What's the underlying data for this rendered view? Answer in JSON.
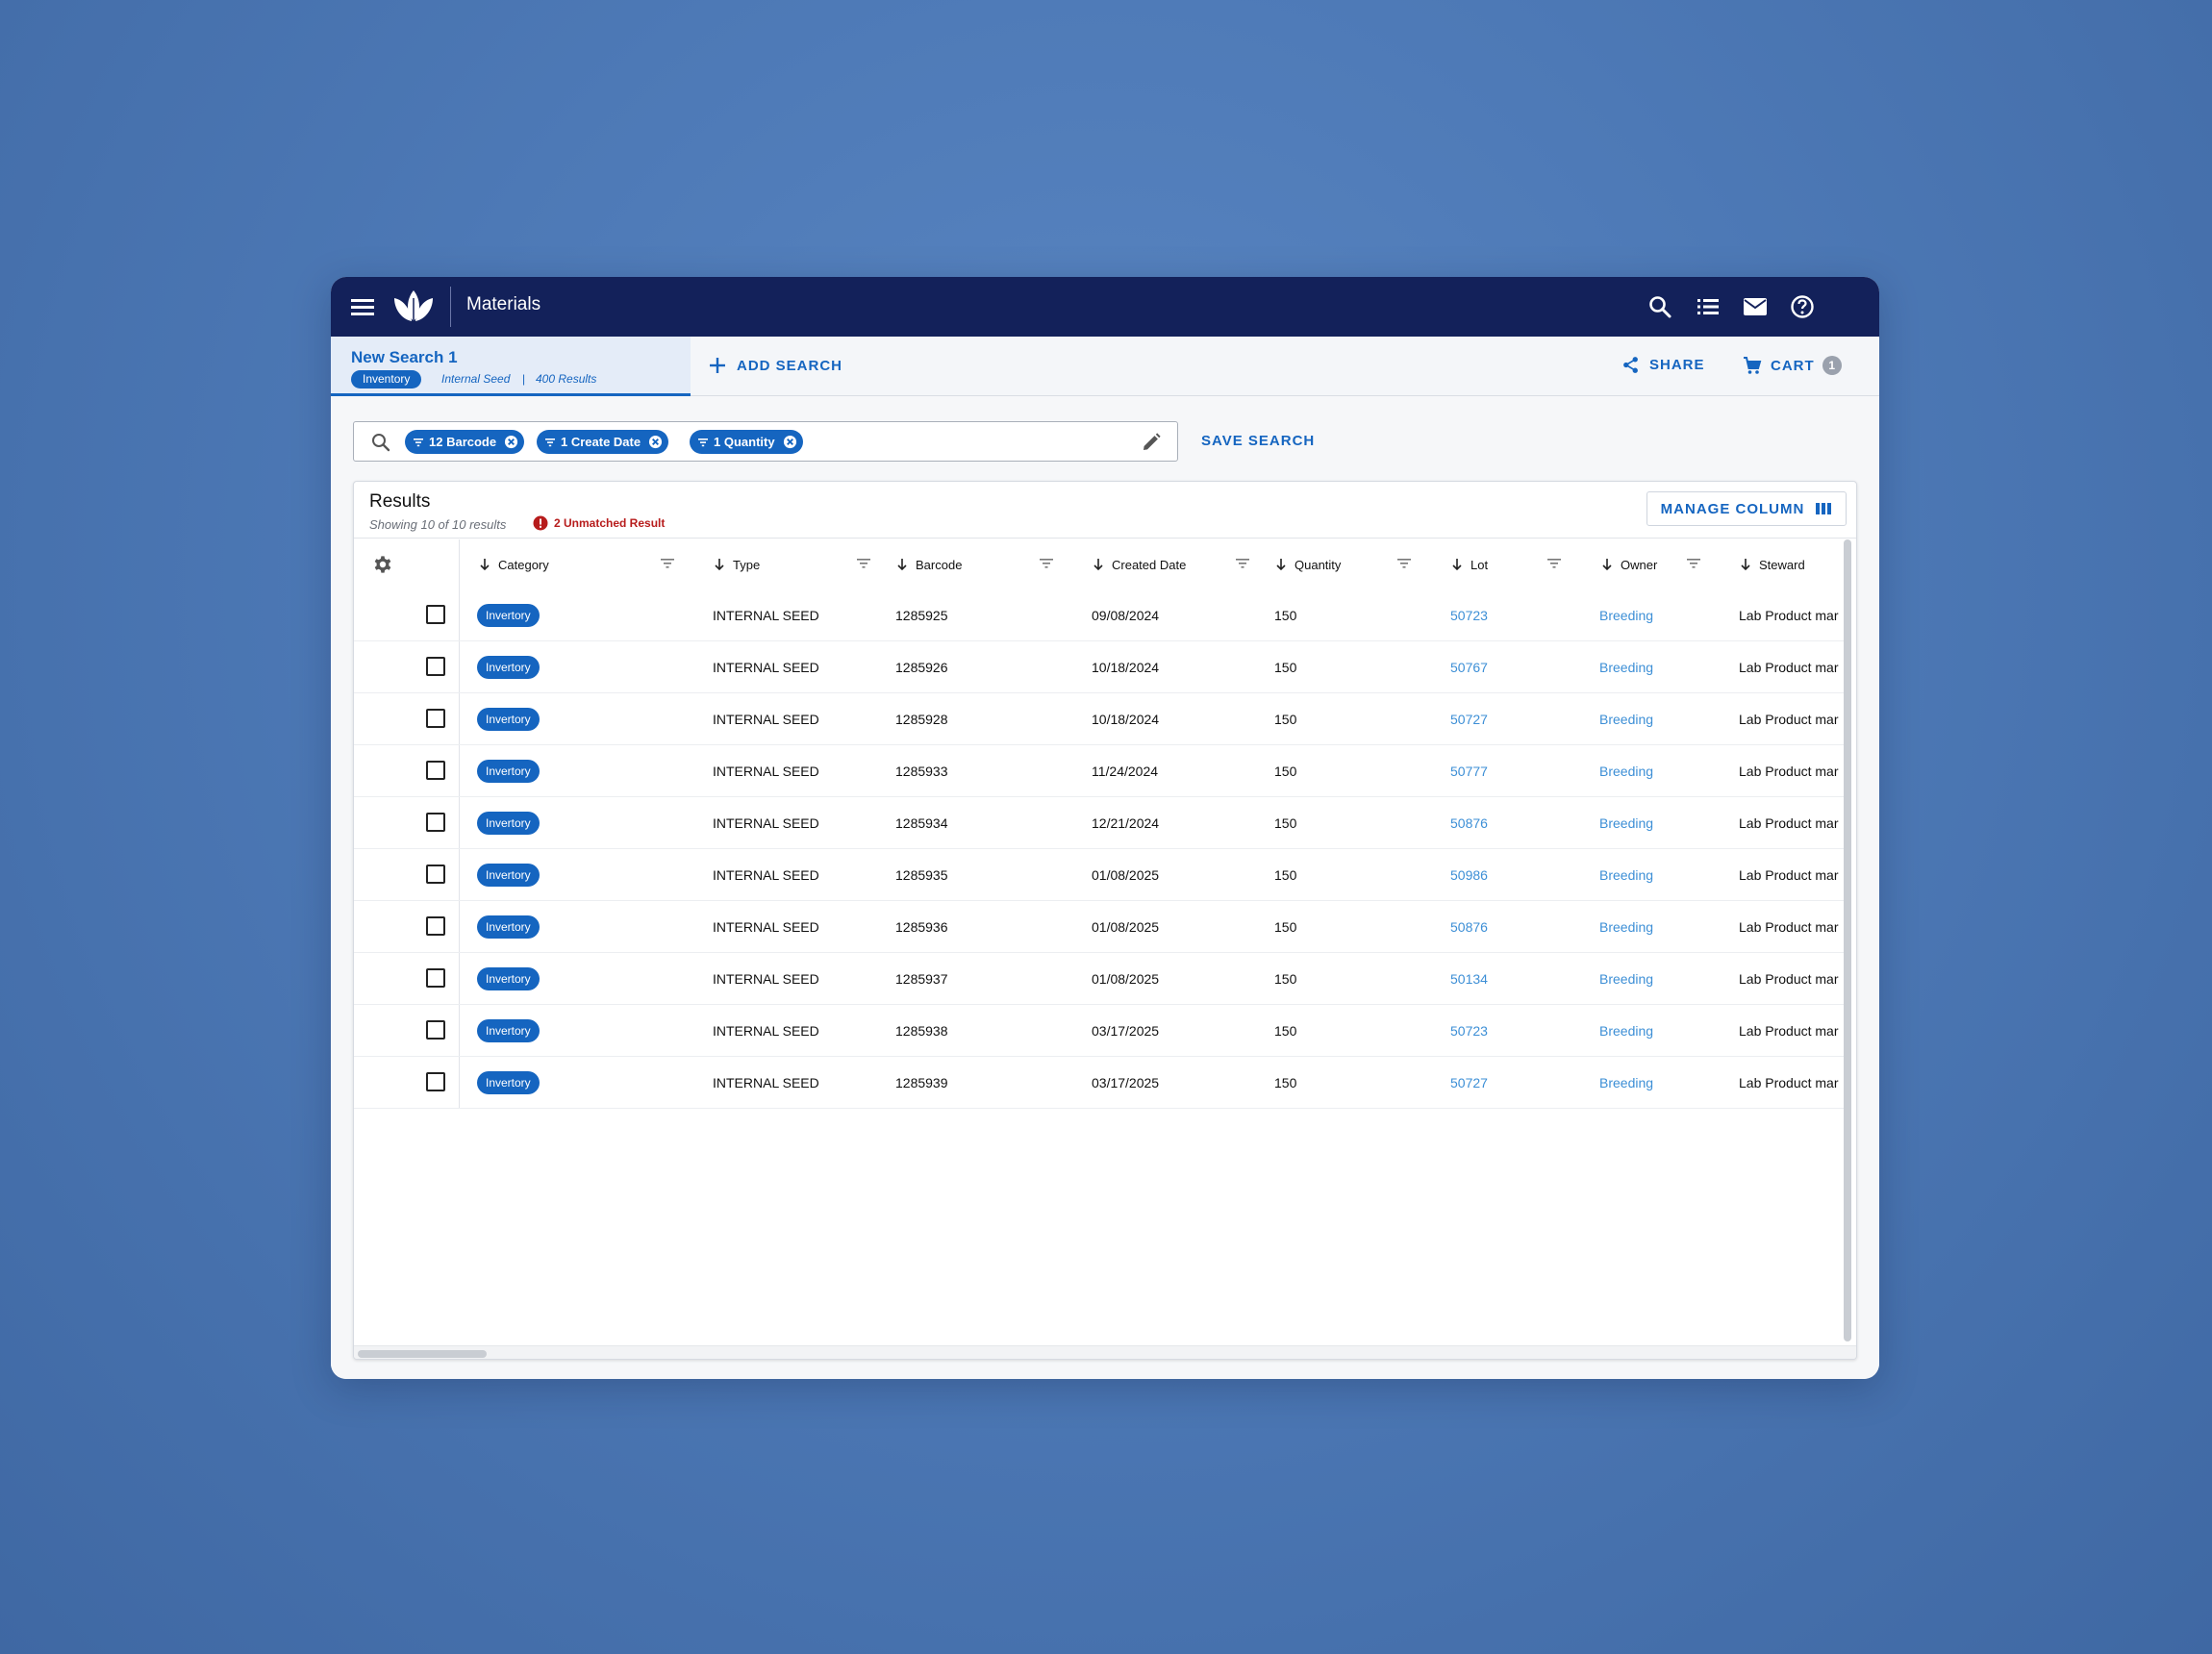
{
  "app": {
    "title": "Materials",
    "icons": [
      "menu-icon",
      "leaf-logo",
      "search-icon",
      "list-icon",
      "mail-icon",
      "help-icon"
    ]
  },
  "tabs": {
    "active": {
      "title": "New Search 1",
      "badge": "Inventory",
      "type": "Internal Seed",
      "separator": "|",
      "results": "400 Results"
    },
    "add_search_label": "ADD SEARCH",
    "share_label": "SHARE",
    "cart_label": "CART",
    "cart_count": "1"
  },
  "search": {
    "chips": [
      {
        "label": "12 Barcode"
      },
      {
        "label": "1 Create Date"
      },
      {
        "label": "1 Quantity"
      }
    ],
    "save_label": "SAVE SEARCH"
  },
  "results": {
    "title": "Results",
    "showing": "Showing 10 of 10 results",
    "unmatched": "2 Unmatched Result",
    "manage_label": "MANAGE COLUMN",
    "columns": [
      "Category",
      "Type",
      "Barcode",
      "Created Date",
      "Quantity",
      "Lot",
      "Owner",
      "Steward"
    ],
    "rows": [
      {
        "category": "Invertory",
        "type": "INTERNAL SEED",
        "barcode": "1285925",
        "created": "09/08/2024",
        "quantity": "150",
        "lot": "50723",
        "owner": "Breeding",
        "steward": "Lab Product mar"
      },
      {
        "category": "Invertory",
        "type": "INTERNAL SEED",
        "barcode": "1285926",
        "created": "10/18/2024",
        "quantity": "150",
        "lot": "50767",
        "owner": "Breeding",
        "steward": "Lab Product mar"
      },
      {
        "category": "Invertory",
        "type": "INTERNAL SEED",
        "barcode": "1285928",
        "created": "10/18/2024",
        "quantity": "150",
        "lot": "50727",
        "owner": "Breeding",
        "steward": "Lab Product mar"
      },
      {
        "category": "Invertory",
        "type": "INTERNAL SEED",
        "barcode": "1285933",
        "created": "11/24/2024",
        "quantity": "150",
        "lot": "50777",
        "owner": "Breeding",
        "steward": "Lab Product mar"
      },
      {
        "category": "Invertory",
        "type": "INTERNAL SEED",
        "barcode": "1285934",
        "created": "12/21/2024",
        "quantity": "150",
        "lot": "50876",
        "owner": "Breeding",
        "steward": "Lab Product mar"
      },
      {
        "category": "Invertory",
        "type": "INTERNAL SEED",
        "barcode": "1285935",
        "created": "01/08/2025",
        "quantity": "150",
        "lot": "50986",
        "owner": "Breeding",
        "steward": "Lab Product mar"
      },
      {
        "category": "Invertory",
        "type": "INTERNAL SEED",
        "barcode": "1285936",
        "created": "01/08/2025",
        "quantity": "150",
        "lot": "50876",
        "owner": "Breeding",
        "steward": "Lab Product mar"
      },
      {
        "category": "Invertory",
        "type": "INTERNAL SEED",
        "barcode": "1285937",
        "created": "01/08/2025",
        "quantity": "150",
        "lot": "50134",
        "owner": "Breeding",
        "steward": "Lab Product mar"
      },
      {
        "category": "Invertory",
        "type": "INTERNAL SEED",
        "barcode": "1285938",
        "created": "03/17/2025",
        "quantity": "150",
        "lot": "50723",
        "owner": "Breeding",
        "steward": "Lab Product mar"
      },
      {
        "category": "Invertory",
        "type": "INTERNAL SEED",
        "barcode": "1285939",
        "created": "03/17/2025",
        "quantity": "150",
        "lot": "50727",
        "owner": "Breeding",
        "steward": "Lab Product mar"
      }
    ]
  },
  "colors": {
    "navy": "#13215a",
    "accent": "#1565c0",
    "link": "#3d8fd6",
    "error": "#b71c1c",
    "background": "#4d79b6"
  }
}
